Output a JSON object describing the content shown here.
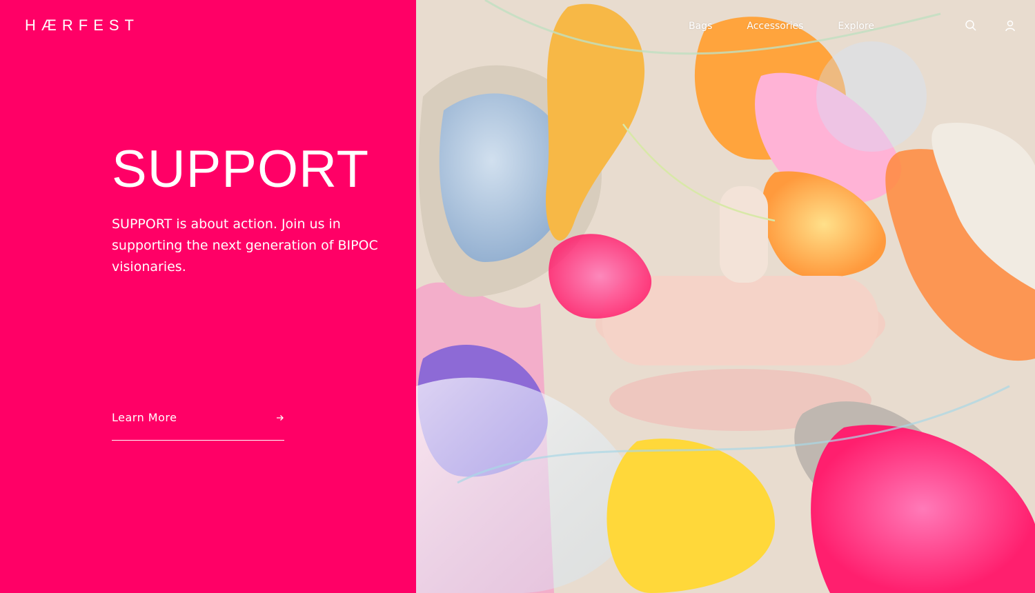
{
  "brand": {
    "logo_text": "HÆRFEST"
  },
  "nav": {
    "items": [
      {
        "label": "Bags"
      },
      {
        "label": "Accessories"
      },
      {
        "label": "Explore"
      }
    ],
    "search_icon": "search-icon",
    "account_icon": "user-icon"
  },
  "hero": {
    "title": "SUPPORT",
    "body": "SUPPORT is about action. Join us in supporting the next generation of BIPOC visionaries.",
    "cta_label": "Learn More"
  },
  "colors": {
    "brand_pink": "#ff0066",
    "text": "#ffffff"
  }
}
